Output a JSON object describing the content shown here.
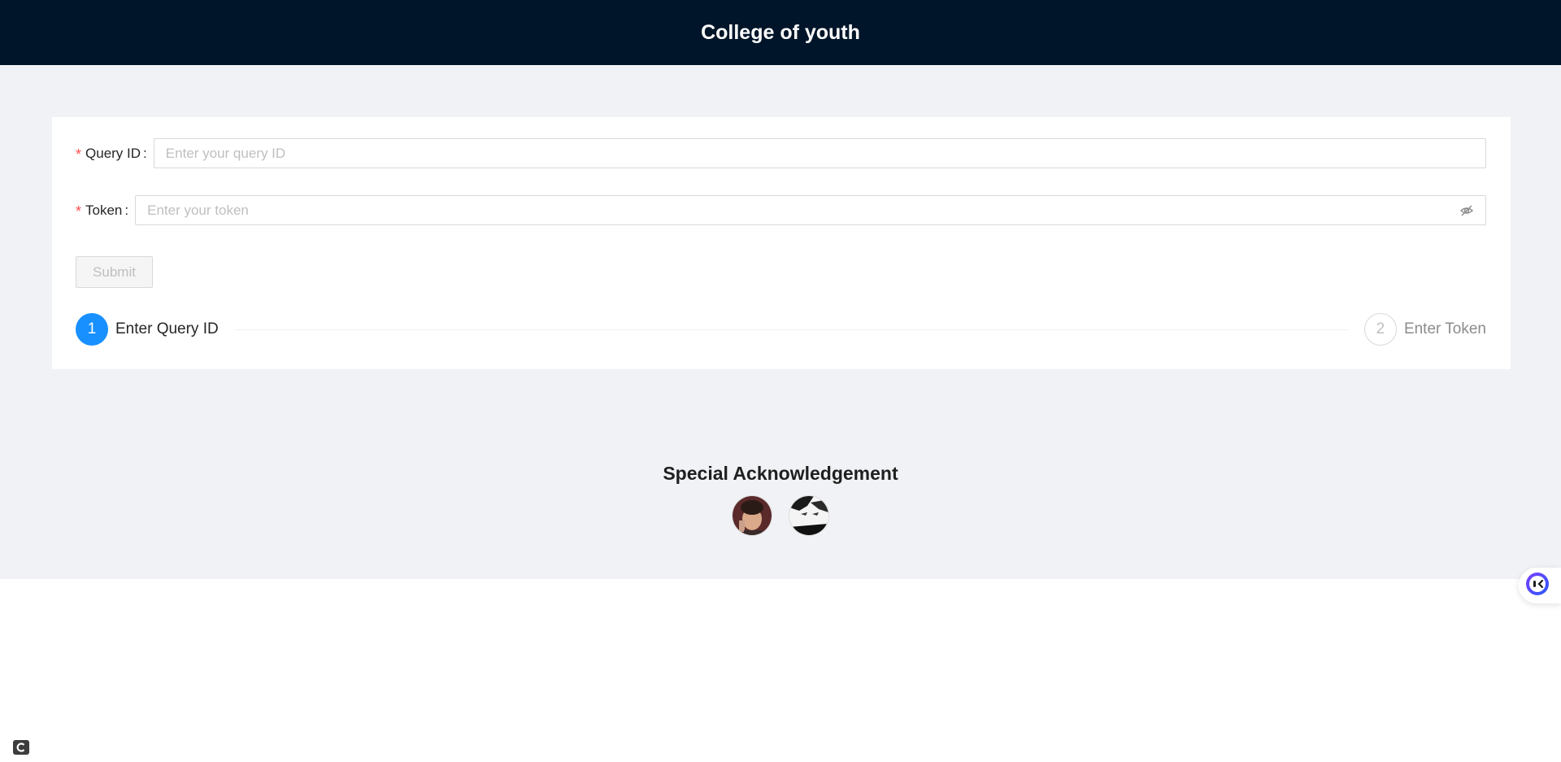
{
  "header": {
    "title": "College of youth"
  },
  "form": {
    "query_id": {
      "label": "Query ID",
      "placeholder": "Enter your query ID",
      "value": ""
    },
    "token": {
      "label": "Token",
      "placeholder": "Enter your token",
      "value": ""
    },
    "submit_label": "Submit",
    "required_mark": "*",
    "colon": ":"
  },
  "steps": [
    {
      "number": "1",
      "title": "Enter Query ID",
      "status": "active"
    },
    {
      "number": "2",
      "title": "Enter Token",
      "status": "wait"
    }
  ],
  "acknowledgement": {
    "title": "Special Acknowledgement"
  },
  "colors": {
    "header_bg": "#001529",
    "page_bg": "#f0f2f5",
    "primary": "#1890ff",
    "required": "#ff4d4f"
  },
  "icons": {
    "password_toggle": "eye-invisible-icon",
    "floating_assistant": "assistant-icon",
    "corner": "c-logo-icon"
  }
}
